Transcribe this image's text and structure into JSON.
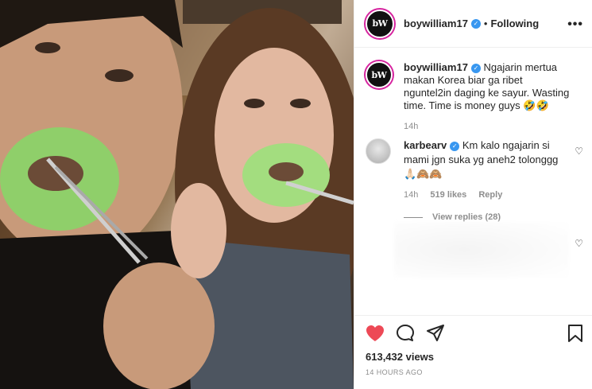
{
  "header": {
    "avatar_text": "bW",
    "username": "boywilliam17",
    "separator": "•",
    "follow_status": "Following",
    "more": "•••"
  },
  "caption": {
    "username": "boywilliam17",
    "text": "Ngajarin mertua makan Korea biar ga ribet nguntel2in daging ke sayur. Wasting time. Time is money guys 🤣🤣",
    "time": "14h"
  },
  "comment": {
    "username": "karbearv",
    "text": "Km kalo ngajarin si mami jgn suka yg aneh2 tolonggg 🙏🏻🙈🙈",
    "time": "14h",
    "likes": "519 likes",
    "reply": "Reply",
    "view_replies": "View replies (28)"
  },
  "footer": {
    "views": "613,432 views",
    "time_ago": "14 HOURS AGO"
  },
  "colors": {
    "like_red": "#ed4956",
    "verified_blue": "#3897f0",
    "muted_text": "#8e8e8e"
  },
  "icons": [
    "heart-icon",
    "comment-icon",
    "share-icon",
    "bookmark-icon",
    "verified-icon",
    "small-heart-icon",
    "more-icon"
  ]
}
